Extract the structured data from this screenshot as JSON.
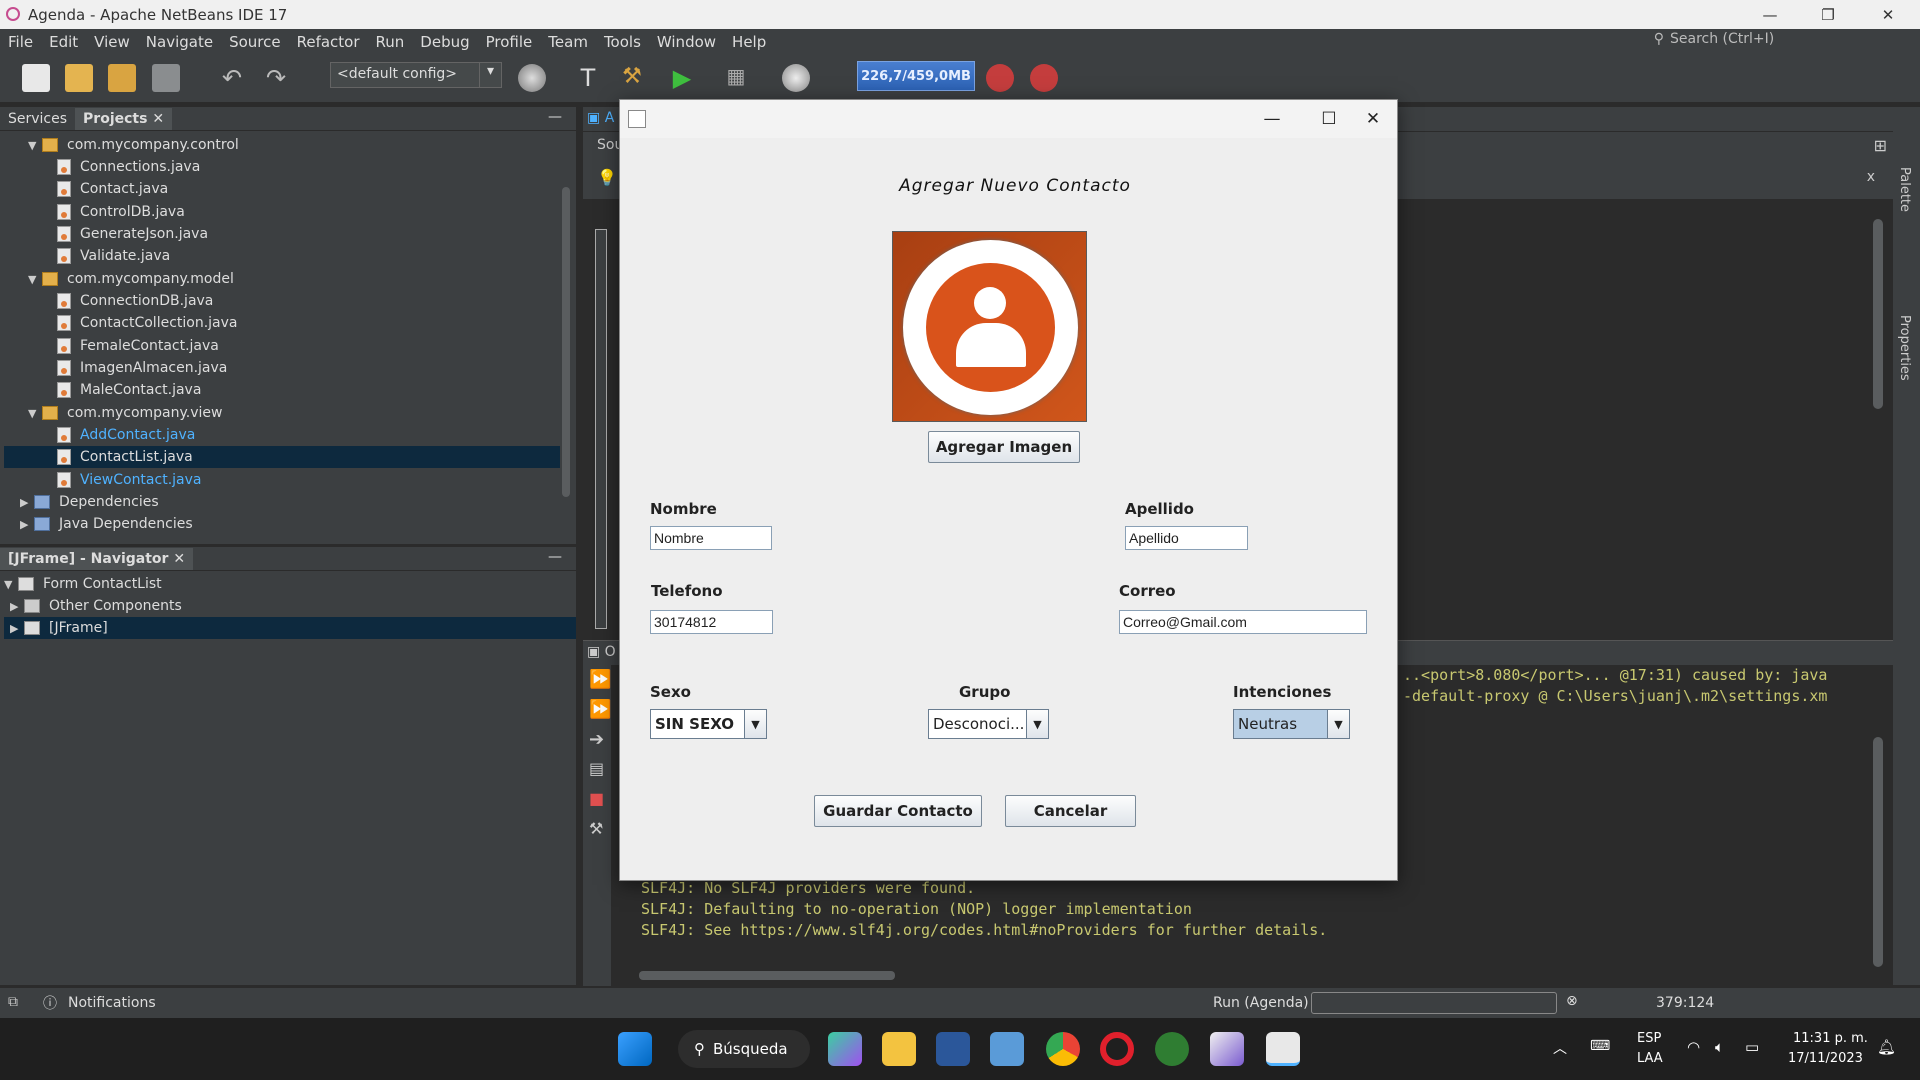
{
  "window": {
    "title": "Agenda - Apache NetBeans IDE 17"
  },
  "menu": [
    "File",
    "Edit",
    "View",
    "Navigate",
    "Source",
    "Refactor",
    "Run",
    "Debug",
    "Profile",
    "Team",
    "Tools",
    "Window",
    "Help"
  ],
  "search": {
    "placeholder": "Search (Ctrl+I)"
  },
  "toolbar": {
    "config": "<default config>",
    "memory": "226,7/459,0MB"
  },
  "projects_panel": {
    "tabs": [
      "Services",
      "Projects"
    ],
    "rows": [
      "com.mycompany.control",
      "Connections.java",
      "Contact.java",
      "ControlDB.java",
      "GenerateJson.java",
      "Validate.java",
      "com.mycompany.model",
      "ConnectionDB.java",
      "ContactCollection.java",
      "FemaleContact.java",
      "ImagenAlmacen.java",
      "MaleContact.java",
      "com.mycompany.view",
      "AddContact.java",
      "ContactList.java",
      "ViewContact.java",
      "Dependencies",
      "Java Dependencies"
    ]
  },
  "navigator": {
    "tab": "[JFrame] - Navigator",
    "rows": [
      "Form ContactList",
      "Other Components",
      "[JFrame]"
    ]
  },
  "editor": {
    "tab_letter": "A",
    "sub_tab": "Sou",
    "close_x": "x"
  },
  "output": {
    "lines_top": [
      "..<port>8.080</port>... @17:31) caused by: java",
      "-default-proxy @ C:\\Users\\juanj\\.m2\\settings.xm"
    ],
    "lines_bottom": [
      "SLF4J: No SLF4J providers were found.",
      "SLF4J: Defaulting to no-operation (NOP) logger implementation",
      "SLF4J: See https://www.slf4j.org/codes.html#noProviders for further details."
    ]
  },
  "right_strip": [
    "Palette",
    "Properties"
  ],
  "statusbar": {
    "notifications": "Notifications",
    "run_label": "Run (Agenda)",
    "position": "379:124"
  },
  "dialog": {
    "heading": "Agregar Nuevo Contacto",
    "add_image": "Agregar Imagen",
    "nombre_label": "Nombre",
    "nombre_value": "Nombre",
    "apellido_label": "Apellido",
    "apellido_value": "Apellido",
    "telefono_label": "Telefono",
    "telefono_value": "30174812",
    "correo_label": "Correo",
    "correo_value": "Correo@Gmail.com",
    "sexo_label": "Sexo",
    "sexo_value": "SIN SEXO",
    "grupo_label": "Grupo",
    "grupo_value": "Desconoci...",
    "intenciones_label": "Intenciones",
    "intenciones_value": "Neutras",
    "save": "Guardar Contacto",
    "cancel": "Cancelar"
  },
  "taskbar": {
    "search": "Búsqueda",
    "lang1": "ESP",
    "lang2": "LAA",
    "time": "11:31 p. m.",
    "date": "17/11/2023"
  }
}
